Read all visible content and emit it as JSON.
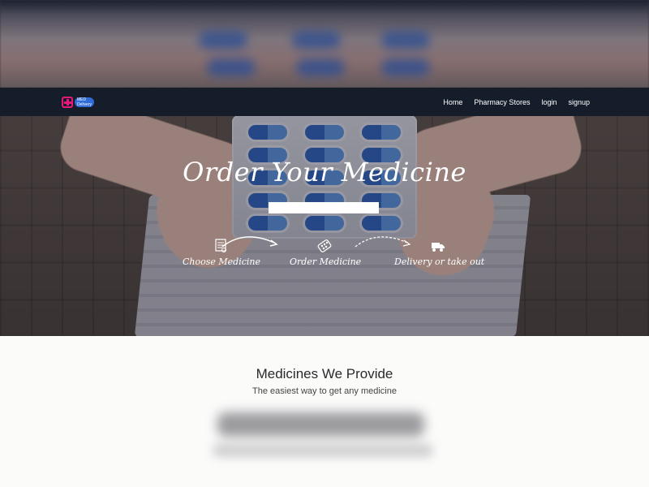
{
  "navbar": {
    "logo": {
      "line1": "MED",
      "line2": "Delivery"
    },
    "links": [
      "Home",
      "Pharmacy Stores",
      "login",
      "signup"
    ]
  },
  "hero": {
    "title": "Order Your Medicine",
    "search": {
      "value": "",
      "placeholder": ""
    },
    "steps": [
      {
        "icon": "list-icon",
        "number": "",
        "label": "Choose Medicine"
      },
      {
        "icon": "pills-icon",
        "number": "",
        "label": "Order Medicine"
      },
      {
        "icon": "delivery-truck-icon",
        "number": "",
        "label": "Delivery or take out"
      }
    ]
  },
  "section": {
    "title": "Medicines We Provide",
    "subtitle": "The easiest way to get any medicine"
  },
  "colors": {
    "navbar": "#161d2a",
    "logo_accent": "#e6197a",
    "logo_badge": "#2f6cd8",
    "step_number": "#e2414b"
  }
}
